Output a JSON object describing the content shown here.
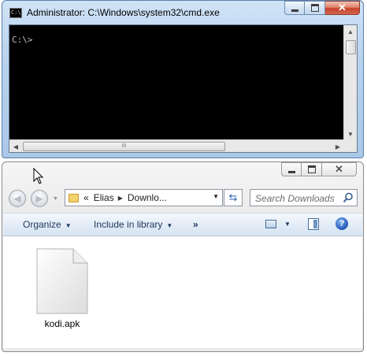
{
  "cmd_window": {
    "title": "Administrator: C:\\Windows\\system32\\cmd.exe",
    "icon_text": "C:\\",
    "console_text": "C:\\>",
    "scroll_grip": "III"
  },
  "caption_buttons": {
    "close_glyph": "✕"
  },
  "explorer": {
    "breadcrumb": {
      "prefix": "«",
      "parts": [
        "Elias",
        "Downlo..."
      ],
      "separator": "▶"
    },
    "search_placeholder": "Search Downloads",
    "toolbar": {
      "organize_label": "Organize",
      "include_label": "Include in library",
      "more_label": "»",
      "help_label": "?"
    },
    "files": [
      {
        "name": "kodi.apk",
        "icon": "generic-file-icon"
      }
    ]
  },
  "colors": {
    "cmd_frame": "#b7d2ee",
    "explorer_toolbar": "#dce7f4",
    "close_button": "#c7412a"
  }
}
